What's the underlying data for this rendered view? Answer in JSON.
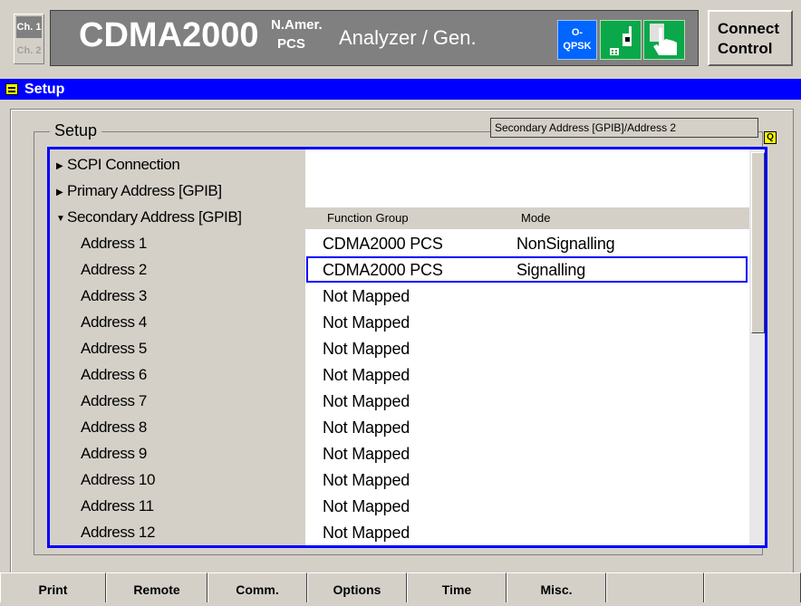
{
  "header": {
    "channels": [
      "Ch. 1",
      "Ch. 2"
    ],
    "title": "CDMA2000",
    "title_sup1": "N.Amer.",
    "title_sup2": "PCS",
    "subtitle": "Analyzer / Gen.",
    "modulation_line1": "O-",
    "modulation_line2": "QPSK",
    "connect_line1": "Connect",
    "connect_line2": "Control"
  },
  "bar": {
    "label": "Setup"
  },
  "setup": {
    "group_title": "Setup",
    "status_text": "Secondary Address [GPIB]/Address 2",
    "tree": [
      {
        "label": "SCPI Connection",
        "expanded": false
      },
      {
        "label": "Primary Address [GPIB]",
        "expanded": false
      },
      {
        "label": "Secondary Address [GPIB]",
        "expanded": true
      }
    ],
    "columns": {
      "function_group": "Function Group",
      "mode": "Mode"
    },
    "rows": [
      {
        "address": "Address 1",
        "function_group": "CDMA2000 PCS",
        "mode": "NonSignalling"
      },
      {
        "address": "Address 2",
        "function_group": "CDMA2000 PCS",
        "mode": "Signalling",
        "selected": true
      },
      {
        "address": "Address 3",
        "function_group": "Not Mapped",
        "mode": ""
      },
      {
        "address": "Address 4",
        "function_group": "Not Mapped",
        "mode": ""
      },
      {
        "address": "Address 5",
        "function_group": "Not Mapped",
        "mode": ""
      },
      {
        "address": "Address 6",
        "function_group": "Not Mapped",
        "mode": ""
      },
      {
        "address": "Address 7",
        "function_group": "Not Mapped",
        "mode": ""
      },
      {
        "address": "Address 8",
        "function_group": "Not Mapped",
        "mode": ""
      },
      {
        "address": "Address 9",
        "function_group": "Not Mapped",
        "mode": ""
      },
      {
        "address": "Address 10",
        "function_group": "Not Mapped",
        "mode": ""
      },
      {
        "address": "Address 11",
        "function_group": "Not Mapped",
        "mode": ""
      },
      {
        "address": "Address 12",
        "function_group": "Not Mapped",
        "mode": ""
      }
    ]
  },
  "tabs": [
    "Print",
    "Remote",
    "Comm.",
    "Options",
    "Time",
    "Misc.",
    "",
    ""
  ],
  "colors": {
    "accent_blue": "#0000ff",
    "indicator_yellow": "#ffff00",
    "button_green": "#0aa84a",
    "button_blue": "#0066ff"
  }
}
